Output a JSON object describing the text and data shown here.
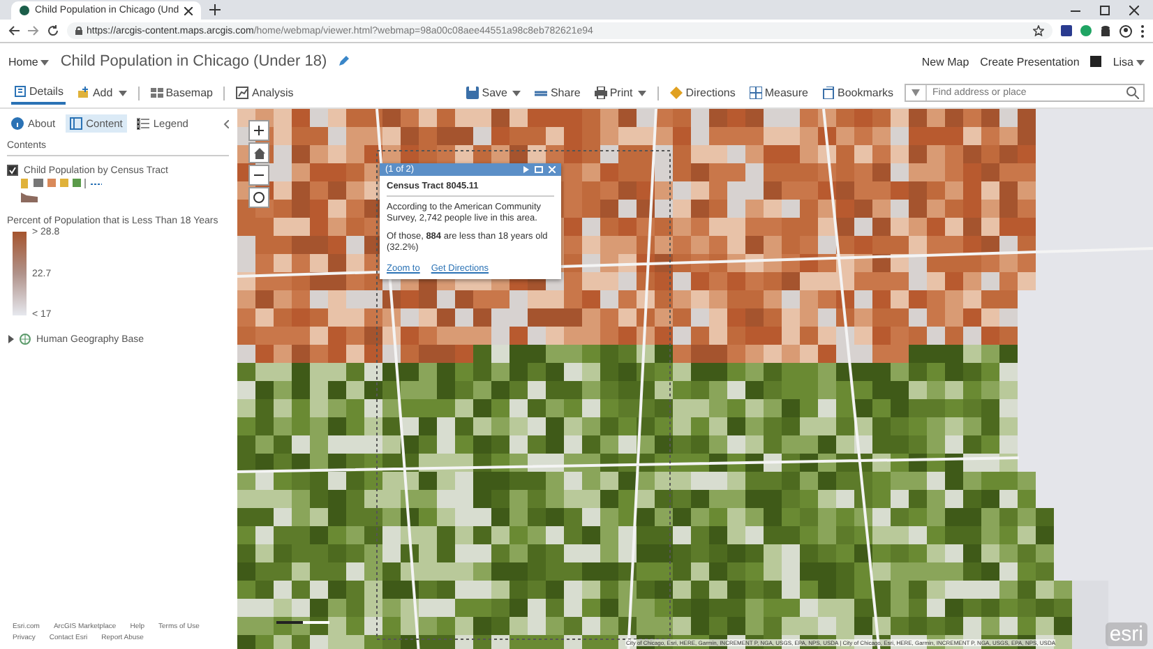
{
  "browser": {
    "tab_title": "Child Population in Chicago (Und",
    "url_host": "https://arcgis-content.maps.arcgis.com",
    "url_path": "/home/webmap/viewer.html?webmap=98a00c08aee44551a98c8eb782621e94"
  },
  "header": {
    "home": "Home",
    "title": "Child Population in Chicago (Under 18)",
    "links": [
      "New Map",
      "Create Presentation"
    ],
    "user": "Lisa"
  },
  "toolbar": {
    "left": [
      {
        "label": "Details",
        "kind": "details",
        "selected": true,
        "dropdown": false
      },
      {
        "label": "Add",
        "kind": "add",
        "selected": false,
        "dropdown": true
      },
      {
        "label": "Basemap",
        "kind": "basemap",
        "selected": false,
        "dropdown": false
      },
      {
        "label": "Analysis",
        "kind": "analysis",
        "selected": false,
        "dropdown": false
      }
    ],
    "right": [
      {
        "label": "Save",
        "kind": "save",
        "dropdown": true
      },
      {
        "label": "Share",
        "kind": "share",
        "dropdown": false
      },
      {
        "label": "Print",
        "kind": "print",
        "dropdown": true
      },
      {
        "label": "Directions",
        "kind": "directions",
        "dropdown": false
      },
      {
        "label": "Measure",
        "kind": "measure",
        "dropdown": false
      },
      {
        "label": "Bookmarks",
        "kind": "bookmarks",
        "dropdown": false
      }
    ],
    "search": {
      "placeholder": "Find address or place"
    }
  },
  "sidebar": {
    "tabs": [
      {
        "label": "About",
        "kind": "about",
        "selected": false
      },
      {
        "label": "Content",
        "kind": "content",
        "selected": true
      },
      {
        "label": "Legend",
        "kind": "legend",
        "selected": false
      }
    ],
    "heading": "Contents",
    "layers": [
      {
        "kind": "layer",
        "name": "Child Population by Census Tract",
        "checked": true,
        "legend_title": "Percent of Population that is Less Than 18 Years",
        "legend_labels": [
          "> 28.8",
          "22.7",
          "< 17"
        ]
      },
      {
        "kind": "group",
        "name": "Human Geography Base",
        "expanded": false
      }
    ],
    "footer": [
      "Esri.com",
      "ArcGIS Marketplace",
      "Help",
      "Terms of Use",
      "Privacy",
      "Contact Esri",
      "Report Abuse"
    ]
  },
  "popup": {
    "counter": "(1 of 2)",
    "title": "Census Tract 8045.11",
    "paragraphs": [
      "According to the American Community Survey, 2,742 people live in this area.",
      "Of those, **884** are less than 18 years old (32.2%)"
    ],
    "actions": [
      "Zoom to",
      "Get Directions"
    ]
  },
  "map": {
    "attribution": "City of Chicago, Esri, HERE, Garmin, INCREMENT P, NGA, USGS, EPA, NPS, USDA | City of Chicago, Esri, HERE, Garmin, INCREMENT P, NGA, USGS, EPA, NPS, USDA",
    "logo": "esri"
  }
}
